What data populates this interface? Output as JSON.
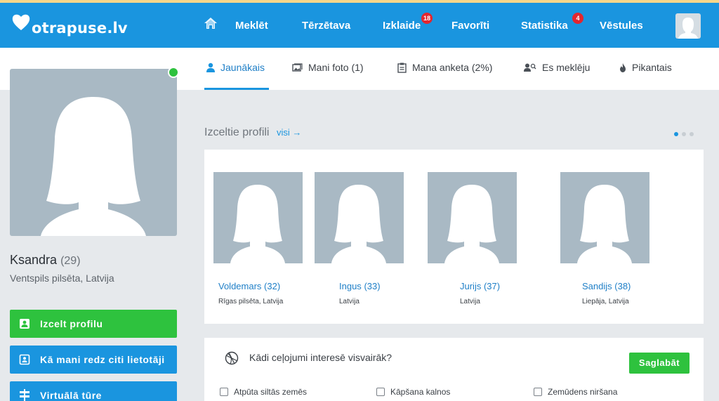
{
  "colors": {
    "header": "#1a95df",
    "green": "#2ec23e",
    "badge": "#e3262f",
    "link": "#1f7fc7"
  },
  "logo": {
    "text": "otrapuse.lv"
  },
  "nav": {
    "items": [
      {
        "label": "Meklēt"
      },
      {
        "label": "Tērzētava"
      },
      {
        "label": "Izklaide",
        "badge": "18"
      },
      {
        "label": "Favorīti"
      },
      {
        "label": "Statistika",
        "badge": "4"
      },
      {
        "label": "Vēstules"
      }
    ]
  },
  "tabs": [
    {
      "label": "Jaunākais",
      "icon": "person-icon"
    },
    {
      "label": "Mani foto (1)",
      "icon": "photos-icon"
    },
    {
      "label": "Mana anketa (2%)",
      "icon": "clipboard-icon"
    },
    {
      "label": "Es meklēju",
      "icon": "people-search-icon"
    },
    {
      "label": "Pikantais",
      "icon": "flame-icon"
    }
  ],
  "profile": {
    "name": "Ksandra",
    "age": "(29)",
    "location": "Ventspils pilsēta, Latvija",
    "buttons": [
      {
        "label": "Izcelt profilu",
        "icon": "badge-icon"
      },
      {
        "label": "Kā mani redz citi lietotāji",
        "icon": "id-card-icon"
      },
      {
        "label": "Virtuālā tūre",
        "icon": "signpost-icon"
      }
    ]
  },
  "featured": {
    "title": "Izceltie profili",
    "all_link": "visi →",
    "people": [
      {
        "name": "Voldemars",
        "age": "(32)",
        "location": "Rīgas pilsēta, Latvija"
      },
      {
        "name": "Ingus",
        "age": "(33)",
        "location": "Latvija"
      },
      {
        "name": "Jurijs",
        "age": "(37)",
        "location": "Latvija"
      },
      {
        "name": "Sandijs",
        "age": "(38)",
        "location": "Liepāja, Latvija"
      }
    ]
  },
  "travel": {
    "question": "Kādi ceļojumi interesē visvairāk?",
    "save_label": "Saglabāt",
    "options": [
      {
        "label": "Atpūta siltās zemēs"
      },
      {
        "label": "Kāpšana kalnos"
      },
      {
        "label": "Zemūdens niršana"
      }
    ]
  }
}
